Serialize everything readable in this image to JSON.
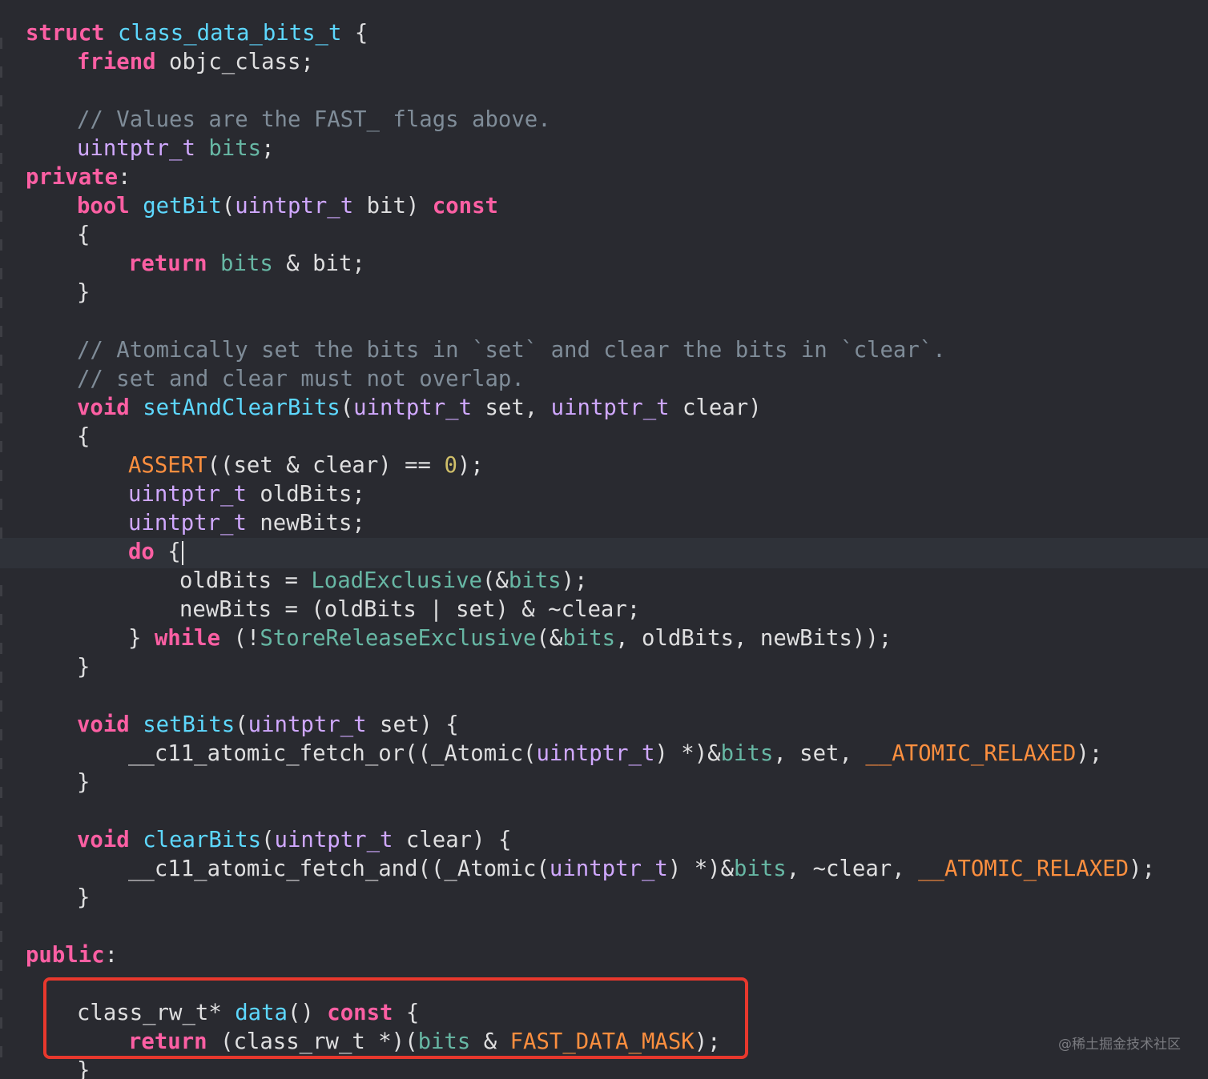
{
  "code": {
    "line01": {
      "kw": "struct",
      "name": "class_data_bits_t",
      "rest": " {"
    },
    "line02": {
      "kw": "friend",
      "rest": " objc_class;"
    },
    "line04": {
      "comment": "// Values are the FAST_ flags above."
    },
    "line05": {
      "type": "uintptr_t",
      "member": "bits",
      "rest": ";"
    },
    "line06": {
      "kw": "private",
      "rest": ":"
    },
    "line07": {
      "kw": "bool",
      "fn": "getBit",
      "p1": "(",
      "type": "uintptr_t",
      "p2": " bit) ",
      "kw2": "const"
    },
    "line08": {
      "text": "{"
    },
    "line09": {
      "kw": "return",
      "member": "bits",
      "rest": " & bit;"
    },
    "line10": {
      "text": "}"
    },
    "line12": {
      "comment": "// Atomically set the bits in `set` and clear the bits in `clear`."
    },
    "line13": {
      "comment": "// set and clear must not overlap."
    },
    "line14": {
      "kw": "void",
      "fn": "setAndClearBits",
      "p1": "(",
      "type1": "uintptr_t",
      "p2": " set, ",
      "type2": "uintptr_t",
      "p3": " clear)"
    },
    "line15": {
      "text": "{"
    },
    "line16": {
      "macro": "ASSERT",
      "p1": "((set & clear) == ",
      "num": "0",
      "p2": ");"
    },
    "line17": {
      "type": "uintptr_t",
      "rest": " oldBits;"
    },
    "line18": {
      "type": "uintptr_t",
      "rest": " newBits;"
    },
    "line19": {
      "kw": "do",
      "rest": " {"
    },
    "line20": {
      "p1": "oldBits = ",
      "fn": "LoadExclusive",
      "p2": "(&",
      "member": "bits",
      "p3": ");"
    },
    "line21": {
      "text": "newBits = (oldBits | set) & ~clear;"
    },
    "line22": {
      "p1": "} ",
      "kw": "while",
      "p2": " (!",
      "fn": "StoreReleaseExclusive",
      "p3": "(&",
      "member": "bits",
      "p4": ", oldBits, newBits));"
    },
    "line23": {
      "text": "}"
    },
    "line25": {
      "kw": "void",
      "fn": "setBits",
      "p1": "(",
      "type": "uintptr_t",
      "p2": " set) {"
    },
    "line26": {
      "p1": "__c11_atomic_fetch_or((_Atomic(",
      "type": "uintptr_t",
      "p2": ") *)&",
      "member": "bits",
      "p3": ", set, ",
      "macro": "__ATOMIC_RELAXED",
      "p4": ");"
    },
    "line27": {
      "text": "}"
    },
    "line29": {
      "kw": "void",
      "fn": "clearBits",
      "p1": "(",
      "type": "uintptr_t",
      "p2": " clear) {"
    },
    "line30": {
      "p1": "__c11_atomic_fetch_and((_Atomic(",
      "type": "uintptr_t",
      "p2": ") *)&",
      "member": "bits",
      "p3": ", ~clear, ",
      "macro": "__ATOMIC_RELAXED",
      "p4": ");"
    },
    "line31": {
      "text": "}"
    },
    "line33": {
      "kw": "public",
      "rest": ":"
    },
    "line34": {
      "cls": "class_rw_t*",
      "fn": "data",
      "p1": "() ",
      "kw": "const",
      "p2": " {"
    },
    "line35": {
      "kw": "return",
      "p1": " (class_rw_t *)(",
      "member": "bits",
      "p2": " & ",
      "macro": "FAST_DATA_MASK",
      "p3": ");"
    },
    "line36": {
      "text": "}"
    }
  },
  "colors": {
    "background": "#292a30",
    "keyword": "#fc5fa3",
    "type": "#d0a8ff",
    "function": "#67b7a4",
    "macro": "#fd8f3f",
    "comment": "#7f8c98",
    "highlight_box": "#e8382d"
  },
  "watermark": "@稀土掘金技术社区"
}
